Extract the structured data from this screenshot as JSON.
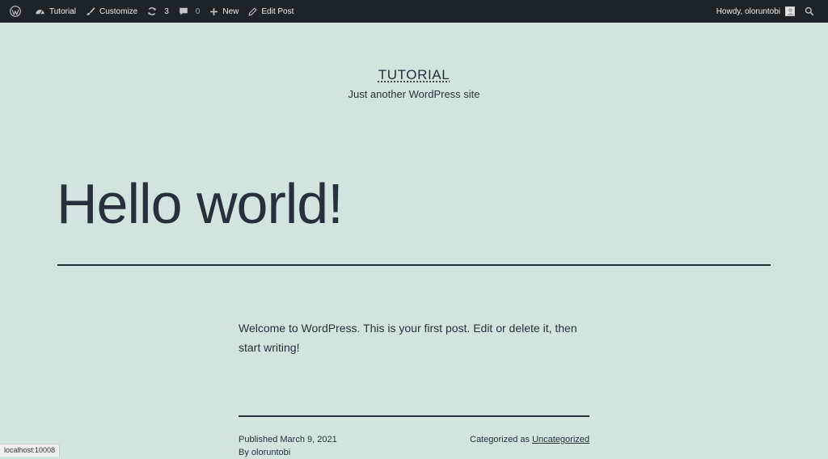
{
  "admin_bar": {
    "site_name": "Tutorial",
    "customize": "Customize",
    "updates_count": "3",
    "comments_count": "0",
    "new_label": "New",
    "edit_post": "Edit Post",
    "greeting": "Howdy, oloruntobi"
  },
  "site": {
    "title": "TUTORIAL",
    "tagline": "Just another WordPress site"
  },
  "post": {
    "title": "Hello world!",
    "content": "Welcome to WordPress. This is your first post. Edit or delete it, then start writing!",
    "published": "Published March 9, 2021",
    "author": "By oloruntobi",
    "categorized_prefix": "Categorized as",
    "category": "Uncategorized"
  },
  "status_bar": {
    "url": "localhost:10008"
  },
  "colors": {
    "background": "#d1e4dd",
    "text": "#28303d",
    "admin_bar": "#1d2327"
  }
}
